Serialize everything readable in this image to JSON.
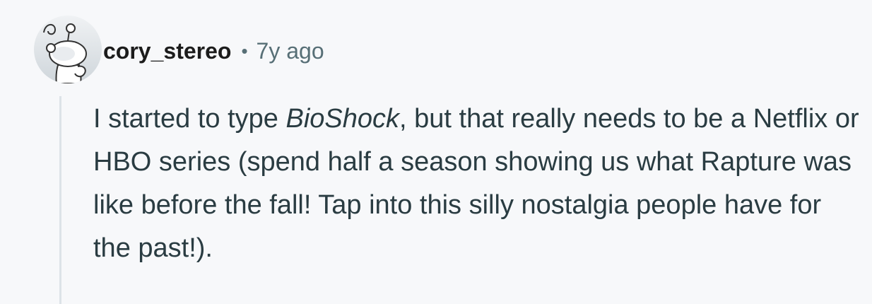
{
  "comment": {
    "author": "cory_stereo",
    "separator": "•",
    "time_ago": "7y ago",
    "avatar_icon": "reddit-snoo-icon",
    "body": {
      "text_before": "I started to type ",
      "emphasis": "BioShock",
      "text_after": ", but that really needs to be a Netflix or HBO series (spend half a season showing us what Rapture was like before the fall! Tap into this silly nostalgia people have for the past!)."
    }
  },
  "colors": {
    "background": "#f7f8fa",
    "username": "#1c1c1c",
    "meta_text": "#576f76",
    "body_text": "#2a3c42",
    "thread_line": "#dde3e8"
  }
}
